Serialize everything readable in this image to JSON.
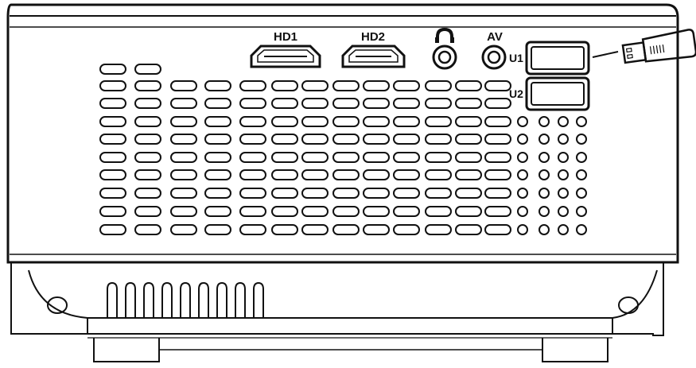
{
  "ports": {
    "hdmi1": "HD1",
    "hdmi2": "HD2",
    "av": "AV",
    "usb1": "U1",
    "usb2": "U2"
  },
  "icons": {
    "headphone": "headphone-icon",
    "usb_plug": "usb-plug-icon"
  },
  "colors": {
    "line": "#111111",
    "background": "#ffffff"
  }
}
